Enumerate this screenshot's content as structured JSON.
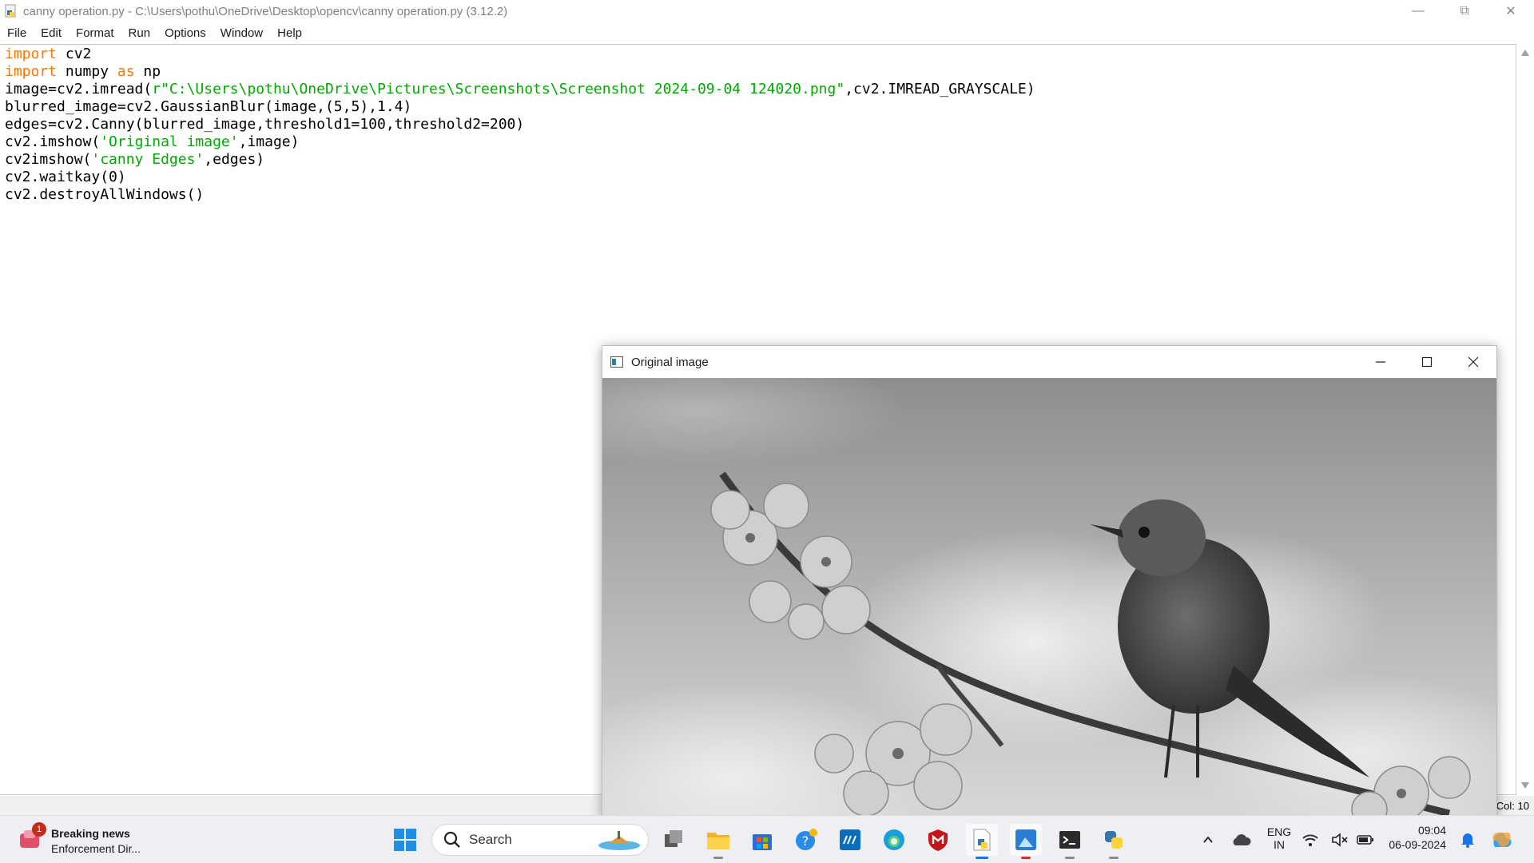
{
  "editor_window": {
    "title": "canny operation.py - C:\\Users\\pothu\\OneDrive\\Desktop\\opencv\\canny operation.py (3.12.2)",
    "menu": [
      "File",
      "Edit",
      "Format",
      "Run",
      "Options",
      "Window",
      "Help"
    ],
    "code_lines": [
      [
        {
          "t": "import",
          "c": "kw"
        },
        {
          "t": " cv2",
          "c": ""
        }
      ],
      [
        {
          "t": "import",
          "c": "kw"
        },
        {
          "t": " numpy ",
          "c": ""
        },
        {
          "t": "as",
          "c": "kw"
        },
        {
          "t": " np",
          "c": ""
        }
      ],
      [
        {
          "t": "image=cv2.imread(",
          "c": ""
        },
        {
          "t": "r\"C:\\Users\\pothu\\OneDrive\\Pictures\\Screenshots\\Screenshot 2024-09-04 124020.png\"",
          "c": "str"
        },
        {
          "t": ",cv2.IMREAD_GRAYSCALE)",
          "c": ""
        }
      ],
      [
        {
          "t": "blurred_image=cv2.GaussianBlur(image,(5,5),1.4)",
          "c": ""
        }
      ],
      [
        {
          "t": "edges=cv2.Canny(blurred_image,threshold1=100,threshold2=200)",
          "c": ""
        }
      ],
      [
        {
          "t": "cv2.imshow(",
          "c": ""
        },
        {
          "t": "'Original image'",
          "c": "str"
        },
        {
          "t": ",image)",
          "c": ""
        }
      ],
      [
        {
          "t": "cv2imshow(",
          "c": ""
        },
        {
          "t": "'canny Edges'",
          "c": "str"
        },
        {
          "t": ",edges)",
          "c": ""
        }
      ],
      [
        {
          "t": "cv2.waitkay(0)",
          "c": ""
        }
      ],
      [
        {
          "t": "cv2.destroyAllWindows()",
          "c": ""
        }
      ]
    ],
    "status_col": "Col: 10"
  },
  "image_window": {
    "title": "Original image"
  },
  "taskbar": {
    "news_badge": "1",
    "news_title": "Breaking news",
    "news_subtitle": "Enforcement Dir...",
    "search_placeholder": "Search",
    "lang_line1": "ENG",
    "lang_line2": "IN",
    "time": "09:04",
    "date": "06-09-2024"
  },
  "colors": {
    "keyword": "#ff7700",
    "string": "#00aa00",
    "taskbar_bg": "#edeff3"
  }
}
